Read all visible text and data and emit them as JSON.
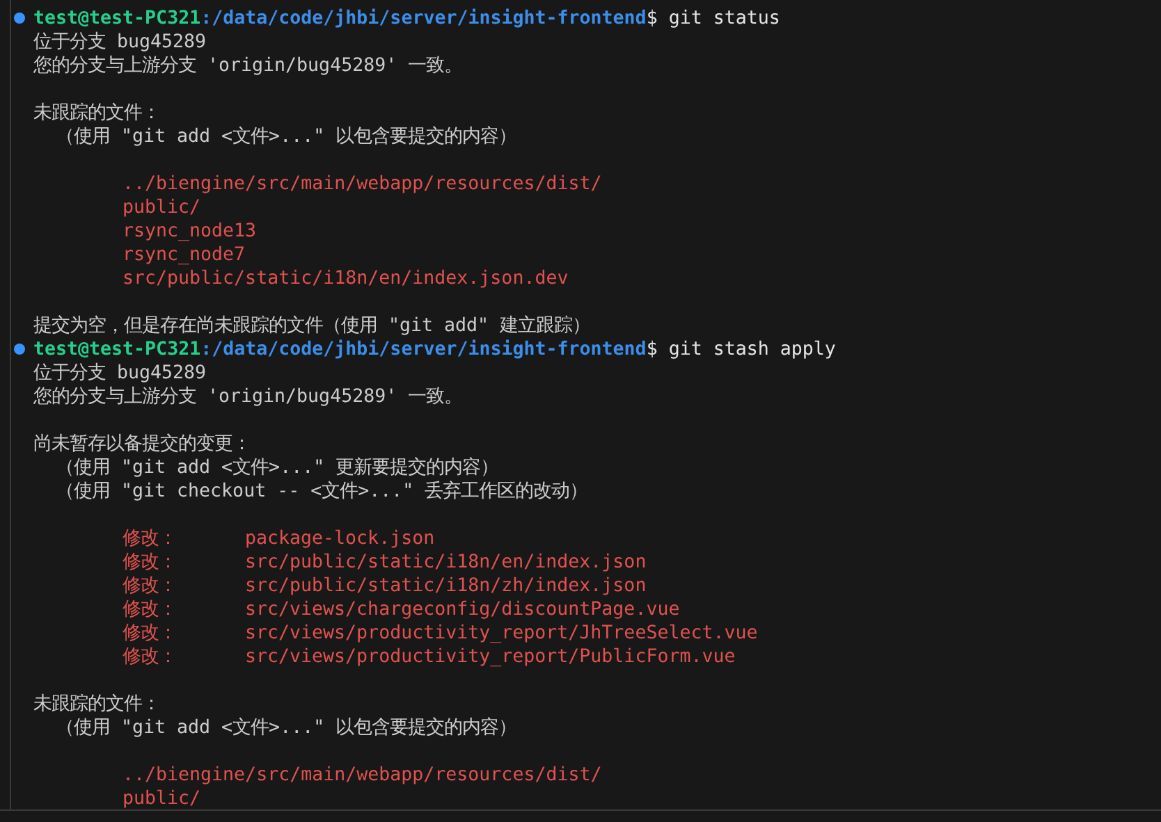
{
  "terminal": {
    "lines": [
      {
        "kind": "prompt",
        "user": "test@test-PC321",
        "path": ":/data/code/jhbi/server/insight-frontend",
        "command": "$ git status"
      },
      {
        "kind": "text",
        "text": "位于分支 bug45289"
      },
      {
        "kind": "text",
        "text": "您的分支与上游分支 'origin/bug45289' 一致。"
      },
      {
        "kind": "blank"
      },
      {
        "kind": "text",
        "text": "未跟踪的文件："
      },
      {
        "kind": "hint",
        "text": "（使用 \"git add <文件>...\" 以包含要提交的内容）"
      },
      {
        "kind": "blank"
      },
      {
        "kind": "file",
        "text": "../biengine/src/main/webapp/resources/dist/"
      },
      {
        "kind": "file",
        "text": "public/"
      },
      {
        "kind": "file",
        "text": "rsync_node13"
      },
      {
        "kind": "file",
        "text": "rsync_node7"
      },
      {
        "kind": "file",
        "text": "src/public/static/i18n/en/index.json.dev"
      },
      {
        "kind": "blank"
      },
      {
        "kind": "text",
        "text": "提交为空，但是存在尚未跟踪的文件（使用 \"git add\" 建立跟踪）"
      },
      {
        "kind": "prompt",
        "user": "test@test-PC321",
        "path": ":/data/code/jhbi/server/insight-frontend",
        "command": "$ git stash apply"
      },
      {
        "kind": "text",
        "text": "位于分支 bug45289"
      },
      {
        "kind": "text",
        "text": "您的分支与上游分支 'origin/bug45289' 一致。"
      },
      {
        "kind": "blank"
      },
      {
        "kind": "text",
        "text": "尚未暂存以备提交的变更："
      },
      {
        "kind": "hint",
        "text": "（使用 \"git add <文件>...\" 更新要提交的内容）"
      },
      {
        "kind": "hint",
        "text": "（使用 \"git checkout -- <文件>...\" 丢弃工作区的改动）"
      },
      {
        "kind": "blank"
      },
      {
        "kind": "modified",
        "label": "修改：",
        "text": "package-lock.json"
      },
      {
        "kind": "modified",
        "label": "修改：",
        "text": "src/public/static/i18n/en/index.json"
      },
      {
        "kind": "modified",
        "label": "修改：",
        "text": "src/public/static/i18n/zh/index.json"
      },
      {
        "kind": "modified",
        "label": "修改：",
        "text": "src/views/chargeconfig/discountPage.vue"
      },
      {
        "kind": "modified",
        "label": "修改：",
        "text": "src/views/productivity_report/JhTreeSelect.vue"
      },
      {
        "kind": "modified",
        "label": "修改：",
        "text": "src/views/productivity_report/PublicForm.vue"
      },
      {
        "kind": "blank"
      },
      {
        "kind": "text",
        "text": "未跟踪的文件："
      },
      {
        "kind": "hint",
        "text": "（使用 \"git add <文件>...\" 以包含要提交的内容）"
      },
      {
        "kind": "blank"
      },
      {
        "kind": "file",
        "text": "../biengine/src/main/webapp/resources/dist/"
      },
      {
        "kind": "file",
        "text": "public/"
      }
    ]
  }
}
